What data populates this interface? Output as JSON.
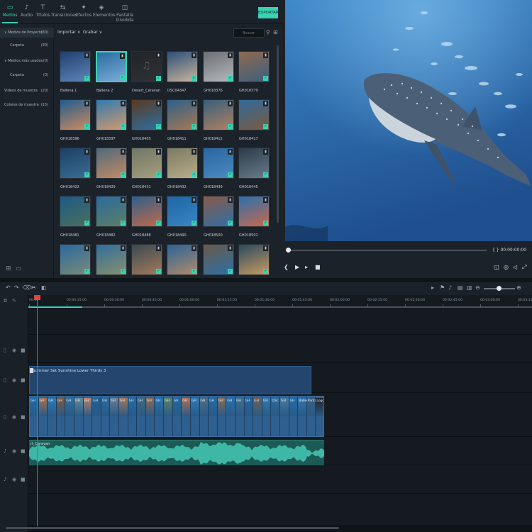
{
  "tabs": [
    {
      "label": "Medios",
      "icon": "folder-icon",
      "active": true
    },
    {
      "label": "Audio",
      "icon": "music-note-icon",
      "active": false
    },
    {
      "label": "Títulos",
      "icon": "text-t-icon",
      "active": false
    },
    {
      "label": "Transiciones",
      "icon": "transition-icon",
      "active": false
    },
    {
      "label": "Efectos",
      "icon": "effects-icon",
      "active": false
    },
    {
      "label": "Elementos",
      "icon": "elements-icon",
      "active": false
    },
    {
      "label": "Pantalla Dividida",
      "icon": "split-screen-icon",
      "active": false
    }
  ],
  "export_label": "EXPORTAR",
  "sidebar": {
    "items": [
      {
        "label": "∨ Medios de Proyecto",
        "count": "(30)"
      },
      {
        "label": "Carpeta",
        "count": "(30)"
      },
      {
        "label": "∨ Medios más usados",
        "count": "(0)"
      },
      {
        "label": "Carpeta",
        "count": "(0)"
      },
      {
        "label": "Videos de muestra",
        "count": "(20)"
      },
      {
        "label": "Colores de muestra",
        "count": "(15)"
      }
    ]
  },
  "media_toolbar": {
    "import_label": "Importar ∨",
    "record_label": "Grabar ∨",
    "search_placeholder": "Buscar"
  },
  "media_items": [
    {
      "name": "Ballena 1",
      "selected": false,
      "checked": true,
      "colors": [
        "#1f3f6e",
        "#5f86b8"
      ]
    },
    {
      "name": "Ballena 2",
      "selected": true,
      "checked": true,
      "colors": [
        "#2a6aa3",
        "#79aed6"
      ]
    },
    {
      "name": "Desert_Caravan",
      "selected": false,
      "checked": true,
      "colors": [
        "#222428",
        "#2f3236"
      ]
    },
    {
      "name": "DSC04347",
      "selected": false,
      "checked": true,
      "colors": [
        "#2d4f7a",
        "#c8b59a"
      ]
    },
    {
      "name": "GH018376",
      "selected": false,
      "checked": true,
      "colors": [
        "#6b6f73",
        "#b5b9bd"
      ]
    },
    {
      "name": "GH018379",
      "selected": false,
      "checked": true,
      "colors": [
        "#8f6a4f",
        "#3d5f7e"
      ]
    },
    {
      "name": "GH018396",
      "selected": false,
      "checked": true,
      "colors": [
        "#1f5d8d",
        "#d18a5f"
      ]
    },
    {
      "name": "GH018397",
      "selected": false,
      "checked": true,
      "colors": [
        "#2f7ab0",
        "#d59a6a"
      ]
    },
    {
      "name": "GH018405",
      "selected": false,
      "checked": true,
      "colors": [
        "#5a3a22",
        "#2e6fa1"
      ]
    },
    {
      "name": "GH018411",
      "selected": false,
      "checked": true,
      "colors": [
        "#2d5f8a",
        "#a87a52"
      ]
    },
    {
      "name": "GH018412",
      "selected": false,
      "checked": true,
      "colors": [
        "#385f7c",
        "#b08062"
      ]
    },
    {
      "name": "GH018417",
      "selected": false,
      "checked": true,
      "colors": [
        "#2f6a9c",
        "#7c5a3e"
      ]
    },
    {
      "name": "GH018422",
      "selected": false,
      "checked": true,
      "colors": [
        "#1e3f63",
        "#3c6d95"
      ]
    },
    {
      "name": "GH018429",
      "selected": false,
      "checked": true,
      "colors": [
        "#4f6a7d",
        "#c28a62"
      ]
    },
    {
      "name": "GH018431",
      "selected": false,
      "checked": true,
      "colors": [
        "#6f7566",
        "#a6a07d"
      ]
    },
    {
      "name": "GH018432",
      "selected": false,
      "checked": true,
      "colors": [
        "#7a7a62",
        "#b8ae8a"
      ]
    },
    {
      "name": "GH018439",
      "selected": false,
      "checked": true,
      "colors": [
        "#2966a0",
        "#4b8bc0"
      ]
    },
    {
      "name": "GH018445",
      "selected": false,
      "checked": true,
      "colors": [
        "#2a3a48",
        "#6a7c8a"
      ]
    },
    {
      "name": "GH018481",
      "selected": false,
      "checked": true,
      "colors": [
        "#1f5a86",
        "#496f5c"
      ]
    },
    {
      "name": "GH018482",
      "selected": false,
      "checked": true,
      "colors": [
        "#2a6a9e",
        "#5c8064"
      ]
    },
    {
      "name": "GH018488",
      "selected": false,
      "checked": true,
      "colors": [
        "#2f5f8c",
        "#c06a48"
      ]
    },
    {
      "name": "GH018490",
      "selected": false,
      "checked": true,
      "colors": [
        "#1e66a6",
        "#3b85c2"
      ]
    },
    {
      "name": "GH018500",
      "selected": false,
      "checked": true,
      "colors": [
        "#8a5a48",
        "#2d6fa6"
      ]
    },
    {
      "name": "GH018501",
      "selected": false,
      "checked": true,
      "colors": [
        "#2a6fb0",
        "#c86a4a"
      ]
    },
    {
      "name": "",
      "selected": false,
      "checked": true,
      "colors": [
        "#2b6aa0",
        "#7a8a78"
      ]
    },
    {
      "name": "",
      "selected": false,
      "checked": true,
      "colors": [
        "#2f6f9e",
        "#88906a"
      ]
    },
    {
      "name": "",
      "selected": false,
      "checked": true,
      "colors": [
        "#3a4a52",
        "#a37a5a"
      ]
    },
    {
      "name": "",
      "selected": false,
      "checked": true,
      "colors": [
        "#2a6498",
        "#b08a6a"
      ]
    },
    {
      "name": "",
      "selected": false,
      "checked": true,
      "colors": [
        "#6a5a4a",
        "#2d6fa4"
      ]
    },
    {
      "name": "",
      "selected": false,
      "checked": true,
      "colors": [
        "#2a4a5e",
        "#c89a62"
      ]
    }
  ],
  "preview": {
    "timecode": "{ } 00:00:00:00",
    "water_top": "#3a85c7",
    "water_bottom": "#1f4f8e"
  },
  "ruler_ticks": [
    "00:00",
    "00:00:15:00",
    "00:00:30:00",
    "00:00:45:00",
    "00:01:00:00",
    "00:01:15:00",
    "00:01:30:00",
    "00:01:45:00",
    "00:02:00:00",
    "00:02:15:00",
    "00:02:30:00",
    "00:02:45:00",
    "00:03:00:00",
    "00:03:15:00"
  ],
  "title_clip": {
    "label": "Summer Set Sunshine Lower Thirds 3"
  },
  "video_clips": [
    {
      "label": "GH",
      "color": "#1f6aa8"
    },
    {
      "label": "GH",
      "color": "#a86f4f"
    },
    {
      "label": "GH",
      "color": "#2a7ab8"
    },
    {
      "label": "GH",
      "color": "#7a5a40"
    },
    {
      "label": "GH",
      "color": "#2f6f9e"
    },
    {
      "label": "GH",
      "color": "#5f8a9e"
    },
    {
      "label": "GH",
      "color": "#b8826a"
    },
    {
      "label": "GH",
      "color": "#1f5f92"
    },
    {
      "label": "GH",
      "color": "#2d6aa0"
    },
    {
      "label": "GH",
      "color": "#6a7f8f"
    },
    {
      "label": "GH",
      "color": "#a8785a"
    },
    {
      "label": "GH",
      "color": "#236aa8"
    },
    {
      "label": "GH",
      "color": "#3a6a80"
    },
    {
      "label": "GH",
      "color": "#8f6a52"
    },
    {
      "label": "GH",
      "color": "#2a72b0"
    },
    {
      "label": "GH",
      "color": "#5a7f6a"
    },
    {
      "label": "GH",
      "color": "#1f66a0"
    },
    {
      "label": "GH",
      "color": "#b07050"
    },
    {
      "label": "GH",
      "color": "#2f78b4"
    },
    {
      "label": "GH",
      "color": "#4f6f80"
    },
    {
      "label": "GH",
      "color": "#226aa6"
    },
    {
      "label": "GH",
      "color": "#8a6a58"
    },
    {
      "label": "GH",
      "color": "#2a6fae"
    },
    {
      "label": "GH",
      "color": "#3c7090"
    },
    {
      "label": "GH",
      "color": "#2065a0"
    },
    {
      "label": "GH",
      "color": "#6f5f50"
    },
    {
      "label": "GH",
      "color": "#2f7ab6"
    },
    {
      "label": "DSC",
      "color": "#2a6a9e"
    },
    {
      "label": "GH",
      "color": "#4a7aa0"
    },
    {
      "label": "GH",
      "color": "#226ca8"
    },
    {
      "label": "Ballena",
      "color": "#2f75b0"
    },
    {
      "label": "Pantall",
      "color": "#3a5f80"
    },
    {
      "label": "Logo C",
      "color": "#202428"
    }
  ],
  "audio_clip": {
    "label": "rt_Caravan"
  }
}
